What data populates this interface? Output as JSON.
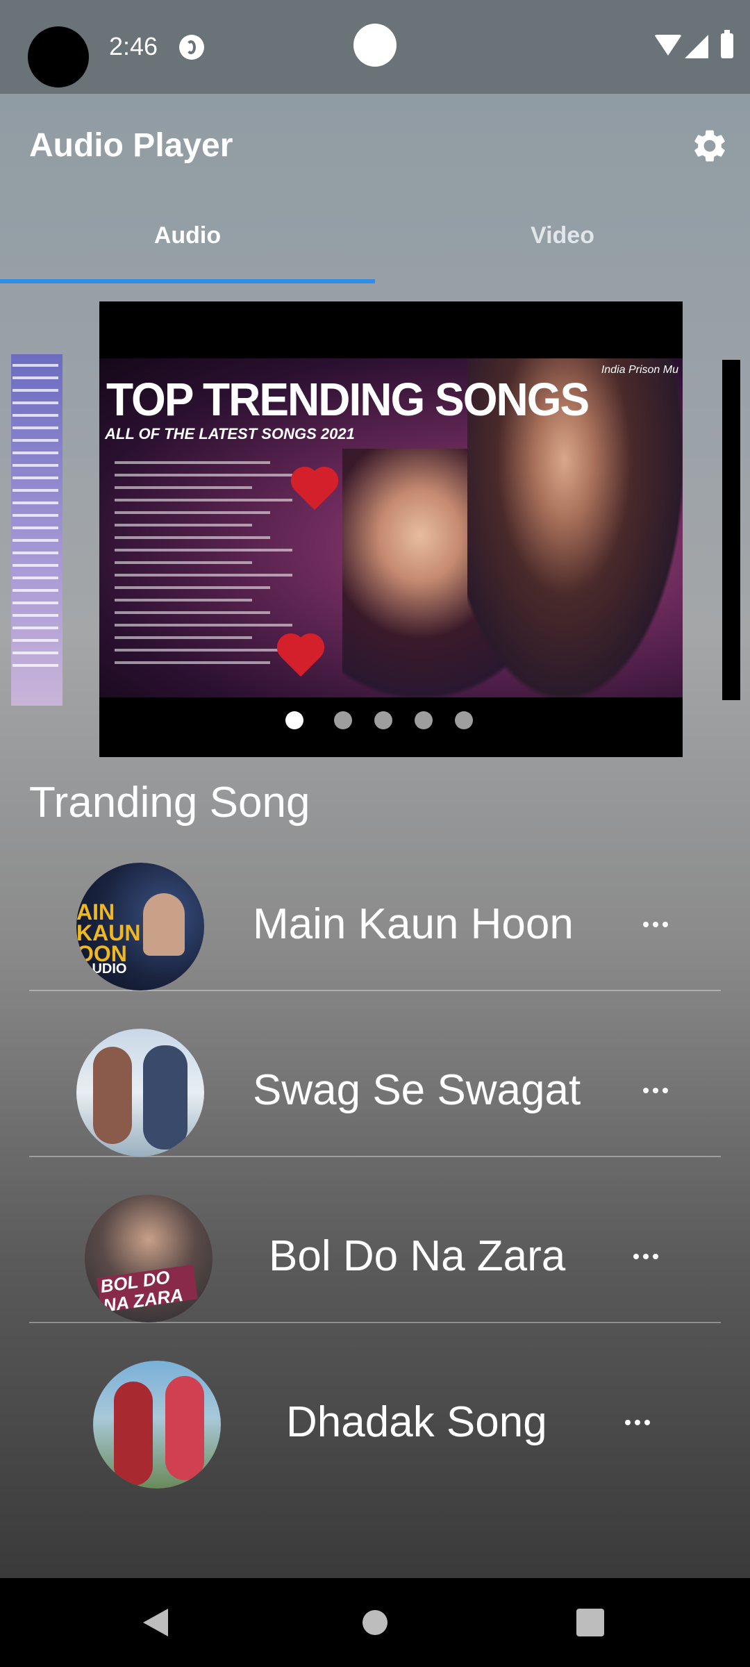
{
  "status_bar": {
    "time": "2:46"
  },
  "app_bar": {
    "title": "Audio Player",
    "settings_icon": "gear-icon"
  },
  "tabs": [
    {
      "label": "Audio",
      "selected": true
    },
    {
      "label": "Video",
      "selected": false
    }
  ],
  "carousel": {
    "banner_title": "TOP TRENDING SONGS",
    "banner_subtitle": "ALL OF THE LATEST SONGS 2021",
    "banner_watermark": "India Prison Mu",
    "page_count": 5,
    "current_page": 1
  },
  "section": {
    "title": "Tranding Song"
  },
  "songs": [
    {
      "title": "Main Kaun Hoon",
      "thumb_text": "MAIN KAUN HOON AUDIO",
      "menu_icon": "more-horizontal-icon"
    },
    {
      "title": "Swag Se Swagat",
      "menu_icon": "more-horizontal-icon"
    },
    {
      "title": "Bol Do Na Zara",
      "thumb_text": "BOL DO NA ZARA",
      "menu_icon": "more-horizontal-icon"
    },
    {
      "title": "Dhadak Song",
      "menu_icon": "more-horizontal-icon"
    }
  ],
  "nav_bar": {
    "back_icon": "back-triangle-icon",
    "home_icon": "home-circle-icon",
    "recents_icon": "recents-square-icon"
  },
  "colors": {
    "tab_indicator": "#2d8de8",
    "status_bar": "#6a7378"
  }
}
